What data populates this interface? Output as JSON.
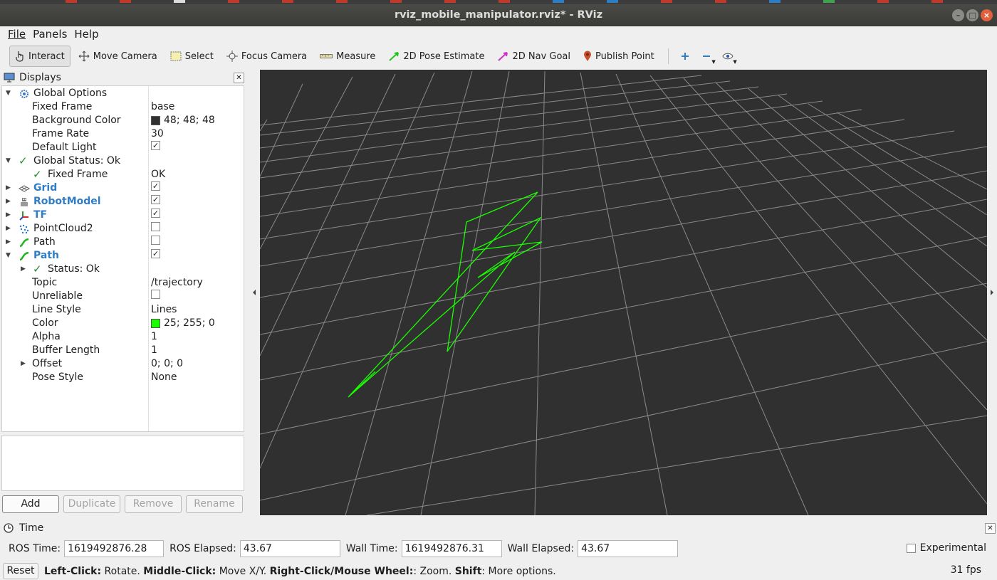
{
  "window": {
    "title": "rviz_mobile_manipulator.rviz* - RViz"
  },
  "menubar": {
    "items": [
      "File",
      "Panels",
      "Help"
    ]
  },
  "toolbar": {
    "tools": [
      {
        "label": "Interact",
        "icon": "cursor-icon",
        "active": true
      },
      {
        "label": "Move Camera",
        "icon": "move-camera-icon"
      },
      {
        "label": "Select",
        "icon": "select-icon"
      },
      {
        "label": "Focus Camera",
        "icon": "focus-camera-icon"
      },
      {
        "label": "Measure",
        "icon": "ruler-icon"
      },
      {
        "label": "2D Pose Estimate",
        "icon": "green-arrow-icon"
      },
      {
        "label": "2D Nav Goal",
        "icon": "magenta-arrow-icon"
      },
      {
        "label": "Publish Point",
        "icon": "map-pin-icon"
      }
    ],
    "extra_icons": [
      "plus-icon",
      "minus-icon",
      "eye-icon"
    ]
  },
  "displays": {
    "title": "Displays",
    "rows": [
      {
        "name": "Global Options",
        "value": ""
      },
      {
        "name": "Fixed Frame",
        "value": "base"
      },
      {
        "name": "Background Color",
        "value": "48; 48; 48",
        "color": "#303030"
      },
      {
        "name": "Frame Rate",
        "value": "30"
      },
      {
        "name": "Default Light",
        "checked": true
      },
      {
        "name": "Global Status: Ok",
        "value": ""
      },
      {
        "name": "Fixed Frame",
        "value": "OK"
      },
      {
        "name": "Grid",
        "checked": true
      },
      {
        "name": "RobotModel",
        "checked": true
      },
      {
        "name": "TF",
        "checked": true
      },
      {
        "name": "PointCloud2",
        "checked": false
      },
      {
        "name": "Path",
        "checked": false
      },
      {
        "name": "Path",
        "checked": true
      },
      {
        "name": "Status: Ok",
        "value": ""
      },
      {
        "name": "Topic",
        "value": "/trajectory"
      },
      {
        "name": "Unreliable",
        "checked": false
      },
      {
        "name": "Line Style",
        "value": "Lines"
      },
      {
        "name": "Color",
        "value": "25; 255; 0",
        "color": "#19ff00"
      },
      {
        "name": "Alpha",
        "value": "1"
      },
      {
        "name": "Buffer Length",
        "value": "1"
      },
      {
        "name": "Offset",
        "value": "0; 0; 0"
      },
      {
        "name": "Pose Style",
        "value": "None"
      }
    ],
    "buttons": {
      "add": "Add",
      "duplicate": "Duplicate",
      "remove": "Remove",
      "rename": "Rename"
    }
  },
  "time_panel": {
    "title": "Time",
    "ros_time_label": "ROS Time:",
    "ros_time": "1619492876.28",
    "ros_elapsed_label": "ROS Elapsed:",
    "ros_elapsed": "43.67",
    "wall_time_label": "Wall Time:",
    "wall_time": "1619492876.31",
    "wall_elapsed_label": "Wall Elapsed:",
    "wall_elapsed": "43.67",
    "experimental_label": "Experimental"
  },
  "statusbar": {
    "reset_label": "Reset",
    "left_click_key": "Left-Click:",
    "left_click_action": " Rotate. ",
    "middle_click_key": "Middle-Click:",
    "middle_click_action": " Move X/Y. ",
    "right_click_key": "Right-Click/Mouse Wheel:",
    "right_click_action": ": Zoom. ",
    "shift_key": "Shift",
    "shift_action": ": More options.",
    "fps": "31 fps"
  },
  "viewport": {
    "background": "#303030",
    "path_color": "#19ff00",
    "grid_color": "#a0a0a0"
  }
}
